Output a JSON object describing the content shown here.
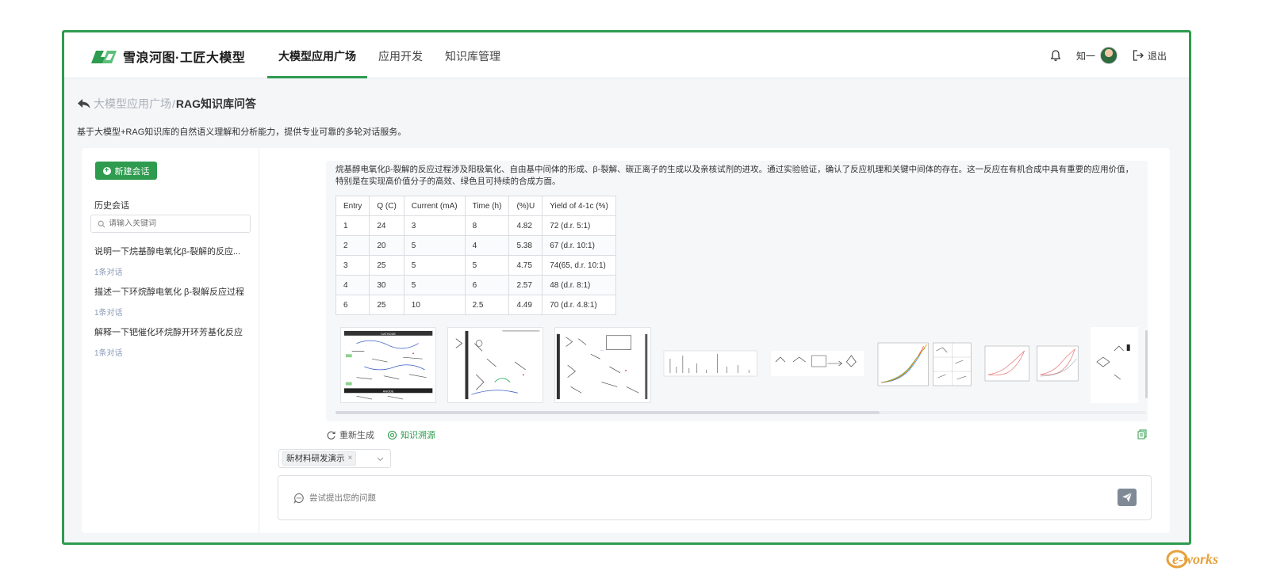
{
  "app": {
    "logo_text": "雪浪河图·工匠大模型",
    "brand_color": "#2e9b4f"
  },
  "nav": {
    "items": [
      {
        "label": "大模型应用广场",
        "active": true
      },
      {
        "label": "应用开发",
        "active": false
      },
      {
        "label": "知识库管理",
        "active": false
      }
    ]
  },
  "header": {
    "user_name": "知一",
    "logout_label": "退出",
    "icons": [
      "bell-icon",
      "avatar",
      "logout-icon"
    ]
  },
  "page": {
    "breadcrumb_prev": "大模型应用广场",
    "breadcrumb_sep": "/",
    "breadcrumb_current": "RAG知识库问答",
    "description": "基于大模型+RAG知识库的自然语义理解和分析能力，提供专业可靠的多轮对话服务。"
  },
  "sidebar": {
    "new_chat_label": "新建会话",
    "history_title": "历史会话",
    "search_placeholder": "请输入关键词",
    "conversations": [
      {
        "title": "说明一下烷基醇电氧化β-裂解的反应...",
        "count": "1条对话"
      },
      {
        "title": "描述一下环烷醇电氧化 β-裂解反应过程",
        "count": "1条对话"
      },
      {
        "title": "解释一下钯催化环烷醇开环芳基化反应",
        "count": "1条对话"
      }
    ]
  },
  "answer": {
    "text": "烷基醇电氧化β-裂解的反应过程涉及阳极氧化、自由基中间体的形成、β-裂解、碳正离子的生成以及亲核试剂的进攻。通过实验验证，确认了反应机理和关键中间体的存在。这一反应在有机合成中具有重要的应用价值，特别是在实现高价值分子的高效、绿色且可持续的合成方面。",
    "table": {
      "headers": [
        "Entry",
        "Q (C)",
        "Current (mA)",
        "Time (h)",
        "(%)U",
        "Yield of 4-1c (%)"
      ],
      "rows": [
        [
          "1",
          "24",
          "3",
          "8",
          "4.82",
          "72 (d.r. 5:1)"
        ],
        [
          "2",
          "20",
          "5",
          "4",
          "5.38",
          "67 (d.r. 10:1)"
        ],
        [
          "3",
          "25",
          "5",
          "5",
          "4.75",
          "74(65, d.r. 10:1)"
        ],
        [
          "4",
          "30",
          "5",
          "6",
          "2.57",
          "48 (d.r. 8:1)"
        ],
        [
          "6",
          "25",
          "10",
          "2.5",
          "4.49",
          "70 (d.r. 4.8:1)"
        ]
      ]
    },
    "figures": [
      "figure-mechanism-cathode-anode",
      "figure-mechanism-radical",
      "figure-mechanism-michael-addition",
      "figure-mass-spectrum",
      "figure-reaction-scheme",
      "figure-voltammetry-curves",
      "figure-cv-plots",
      "figure-structure-fragment"
    ],
    "figure_labels": {
      "cathode": "CATHODE",
      "anode": "ANODE"
    }
  },
  "actions": {
    "regenerate_label": "重新生成",
    "source_label": "知识溯源"
  },
  "knowledge_base": {
    "selected_tag": "新材料研发演示",
    "tag_close": "×"
  },
  "input": {
    "placeholder": "尝试提出您的问题"
  },
  "watermark": {
    "text": "e-works"
  }
}
